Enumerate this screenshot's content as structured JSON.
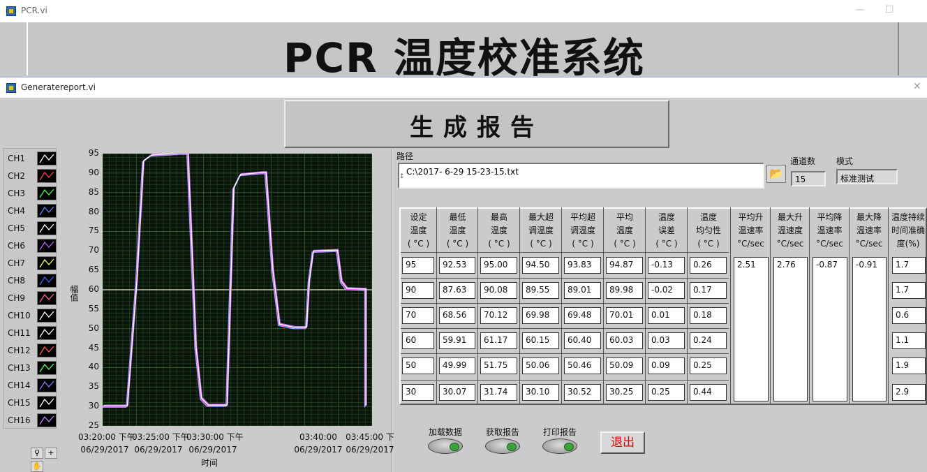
{
  "outer_window": {
    "title": "PCR.vi",
    "banner": "PCR 温度校准系统"
  },
  "inner_window": {
    "title": "Generatereport.vi"
  },
  "header": {
    "title": "生成报告"
  },
  "legend": [
    "CH1",
    "CH2",
    "CH3",
    "CH4",
    "CH5",
    "CH6",
    "CH7",
    "CH8",
    "CH9",
    "CH10",
    "CH11",
    "CH12",
    "CH13",
    "CH14",
    "CH15",
    "CH16"
  ],
  "legend_colors": [
    "#ffffff",
    "#ff4040",
    "#40ff40",
    "#6080ff",
    "#ffffff",
    "#b060ff",
    "#ffff60",
    "#4060ff",
    "#ff60a0",
    "#ffffff",
    "#ffffff",
    "#ff6040",
    "#60ff60",
    "#8080ff",
    "#ffffff",
    "#c080ff"
  ],
  "chart_data": {
    "type": "line",
    "ylabel": "幅值",
    "xlabel": "时间",
    "ylim": [
      25,
      95
    ],
    "yticks": [
      95,
      90,
      85,
      80,
      75,
      70,
      65,
      60,
      55,
      50,
      45,
      40,
      35,
      30,
      25
    ],
    "xtick_labels": [
      {
        "time": "03:20:00 下午",
        "date": "06/29/2017"
      },
      {
        "time": "03:25:00 下午",
        "date": "06/29/2017"
      },
      {
        "time": "03:30:00 下午",
        "date": "06/29/2017"
      },
      {
        "time": "03:40:00",
        "date": "06/29/2017"
      },
      {
        "time": "03:45:00 下",
        "date": "06/29/2017"
      }
    ],
    "grid": true,
    "series": [
      {
        "values": [
          [
            0,
            30
          ],
          [
            1.8,
            30
          ],
          [
            2.5,
            62
          ],
          [
            3.0,
            93
          ],
          [
            3.6,
            94.5
          ],
          [
            5.8,
            95
          ],
          [
            6.3,
            95
          ],
          [
            6.9,
            45
          ],
          [
            7.3,
            32
          ],
          [
            7.8,
            30.2
          ],
          [
            8.7,
            30.2
          ],
          [
            9.2,
            30.2
          ],
          [
            9.7,
            86
          ],
          [
            10.2,
            89.5
          ],
          [
            11.8,
            90
          ],
          [
            12.1,
            90
          ],
          [
            12.6,
            65
          ],
          [
            13.1,
            51
          ],
          [
            14.2,
            50.2
          ],
          [
            15.1,
            50.2
          ],
          [
            15.3,
            62
          ],
          [
            15.6,
            69.8
          ],
          [
            17.2,
            70
          ],
          [
            17.4,
            70
          ],
          [
            17.7,
            62
          ],
          [
            18.1,
            60.2
          ],
          [
            19.5,
            60
          ],
          [
            19.5,
            30
          ]
        ]
      }
    ],
    "reference_line": 60
  },
  "path": {
    "label": "路径",
    "value": "C:\\2017- 6-29  15-23-15.txt"
  },
  "channels": {
    "label": "通道数",
    "value": "15"
  },
  "mode": {
    "label": "模式",
    "value": "标准测试"
  },
  "table": {
    "headers": [
      [
        "设定",
        "温度",
        "(  °C  )"
      ],
      [
        "最低",
        "温度",
        "(  °C  )"
      ],
      [
        "最高",
        "温度",
        "(  °C  )"
      ],
      [
        "最大超",
        "调温度",
        "(  °C  )"
      ],
      [
        "平均超",
        "调温度",
        "(  °C  )"
      ],
      [
        "平均",
        "温度",
        "(  °C  )"
      ],
      [
        "温度",
        "误差",
        "(  °C  )"
      ],
      [
        "温度",
        "均匀性",
        "(  °C  )"
      ],
      [
        "平均升",
        "温速率",
        "°C/sec"
      ],
      [
        "最大升",
        "温速度",
        "°C/sec"
      ],
      [
        "平均降",
        "温速率",
        "°C/sec"
      ],
      [
        "最大降",
        "温速率",
        "°C/sec"
      ],
      [
        "温度持续",
        "时间准确",
        "度(%)"
      ]
    ],
    "rows": [
      [
        "95",
        "92.53",
        "95.00",
        "94.50",
        "93.83",
        "94.87",
        "-0.13",
        "0.26"
      ],
      [
        "90",
        "87.63",
        "90.08",
        "89.55",
        "89.01",
        "89.98",
        "-0.02",
        "0.17"
      ],
      [
        "70",
        "68.56",
        "70.12",
        "69.98",
        "69.48",
        "70.01",
        "0.01",
        "0.18"
      ],
      [
        "60",
        "59.91",
        "61.17",
        "60.15",
        "60.40",
        "60.03",
        "0.03",
        "0.24"
      ],
      [
        "50",
        "49.99",
        "51.75",
        "50.06",
        "50.46",
        "50.09",
        "0.09",
        "0.25"
      ],
      [
        "30",
        "30.07",
        "31.74",
        "30.10",
        "30.52",
        "30.25",
        "0.25",
        "0.44"
      ]
    ],
    "rates": [
      "2.51",
      "2.76",
      "-0.87",
      "-0.91"
    ],
    "accuracy": [
      "1.7",
      "1.7",
      "0.6",
      "1.1",
      "1.9",
      "2.9"
    ]
  },
  "buttons": {
    "load": "加载数据",
    "get": "获取报告",
    "print": "打印报告",
    "exit": "退出"
  }
}
